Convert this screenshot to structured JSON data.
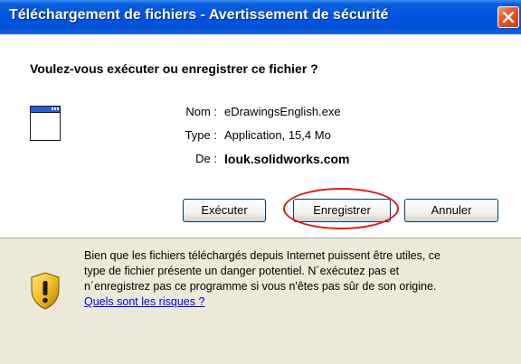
{
  "window": {
    "title": "Téléchargement de fichiers - Avertissement de sécurité"
  },
  "prompt": {
    "question": "Voulez-vous exécuter ou enregistrer ce fichier ?"
  },
  "file": {
    "name_label": "Nom :",
    "name_value": "eDrawingsEnglish.exe",
    "type_label": "Type :",
    "type_value": "Application, 15,4 Mo",
    "from_label": "De :",
    "from_value": "louk.solidworks.com"
  },
  "buttons": {
    "run_label": "Exécuter",
    "save_label": "Enregistrer",
    "cancel_label": "Annuler"
  },
  "warning": {
    "line1": "Bien que les fichiers téléchargés depuis Internet puissent être utiles, ce",
    "line2": "type de fichier présente un danger potentiel. N´exécutez pas et",
    "line3": "n´enregistrez pas ce programme si vous n'êtes pas sûr de son origine.",
    "risk_link": "Quels sont les risques ?"
  },
  "colors": {
    "titlebar": "#0054e3",
    "close_button": "#e55b2b",
    "highlight_ring": "#e01818",
    "link": "#0000ee"
  },
  "icons": {
    "app": "application-window-icon",
    "warning": "security-shield-icon",
    "close": "close-icon"
  }
}
